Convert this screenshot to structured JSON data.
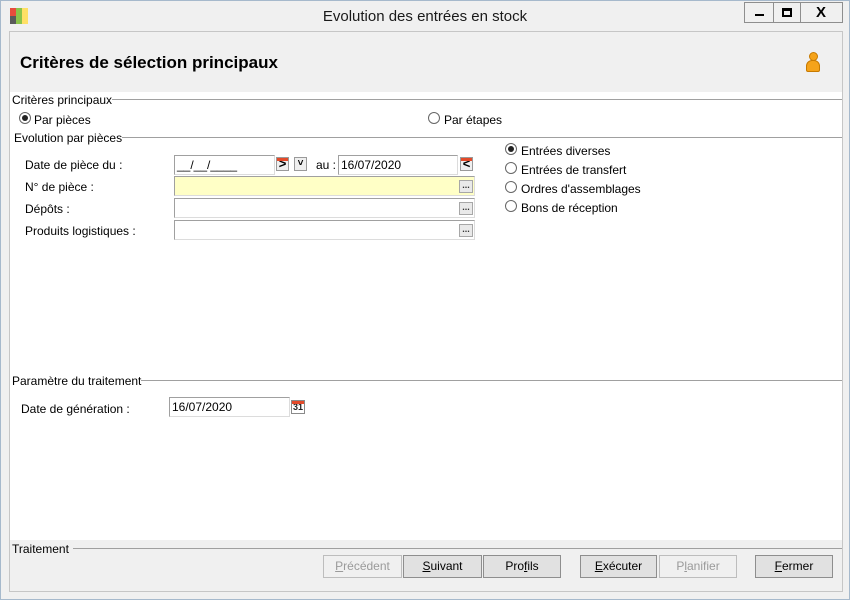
{
  "window": {
    "title": "Evolution des entrées en stock",
    "close_glyph": "X"
  },
  "header": {
    "title": "Critères de sélection principaux"
  },
  "criteria": {
    "group_title": "Critères principaux",
    "mode_options": [
      {
        "label": "Par pièces",
        "selected": true
      },
      {
        "label": "Par étapes",
        "selected": false
      }
    ]
  },
  "evolution": {
    "group_title": "Evolution par pièces",
    "date_label": "Date de pièce du :",
    "date_from": "__/__/____",
    "date_to_label": "au :",
    "date_to": "16/07/2020",
    "piece_label": "N° de pièce  :",
    "piece_value": "",
    "depots_label": "Dépôts :",
    "depots_value": "",
    "produits_label": "Produits logistiques :",
    "produits_value": "",
    "types": [
      {
        "label": "Entrées diverses",
        "selected": true
      },
      {
        "label": "Entrées de transfert",
        "selected": false
      },
      {
        "label": "Ordres d'assemblages",
        "selected": false
      },
      {
        "label": "Bons de réception",
        "selected": false
      }
    ],
    "ellipsis": "...",
    "arrow_next": ">",
    "arrow_prev": "<",
    "dropdown_glyph": "˅"
  },
  "params": {
    "group_title": "Paramètre du traitement",
    "generation_label": "Date de génération :",
    "generation_date": "16/07/2020",
    "cal_day": "31"
  },
  "footer": {
    "group_title": "Traitement",
    "buttons": {
      "previous": {
        "prefix": "",
        "accel": "P",
        "rest": "récédent",
        "enabled": false
      },
      "next": {
        "prefix": "",
        "accel": "S",
        "rest": "uivant",
        "enabled": true
      },
      "profiles": {
        "prefix": "Pro",
        "accel": "f",
        "rest": "ils",
        "enabled": true
      },
      "execute": {
        "prefix": "",
        "accel": "E",
        "rest": "xécuter",
        "enabled": true
      },
      "schedule": {
        "prefix": "P",
        "accel": "l",
        "rest": "anifier",
        "enabled": false
      },
      "close": {
        "prefix": "",
        "accel": "F",
        "rest": "ermer",
        "enabled": true
      }
    }
  },
  "colors": {
    "required_field_bg": "#ffffc6",
    "accent_red": "#e34a2a",
    "user_icon": "#f5a31a"
  }
}
